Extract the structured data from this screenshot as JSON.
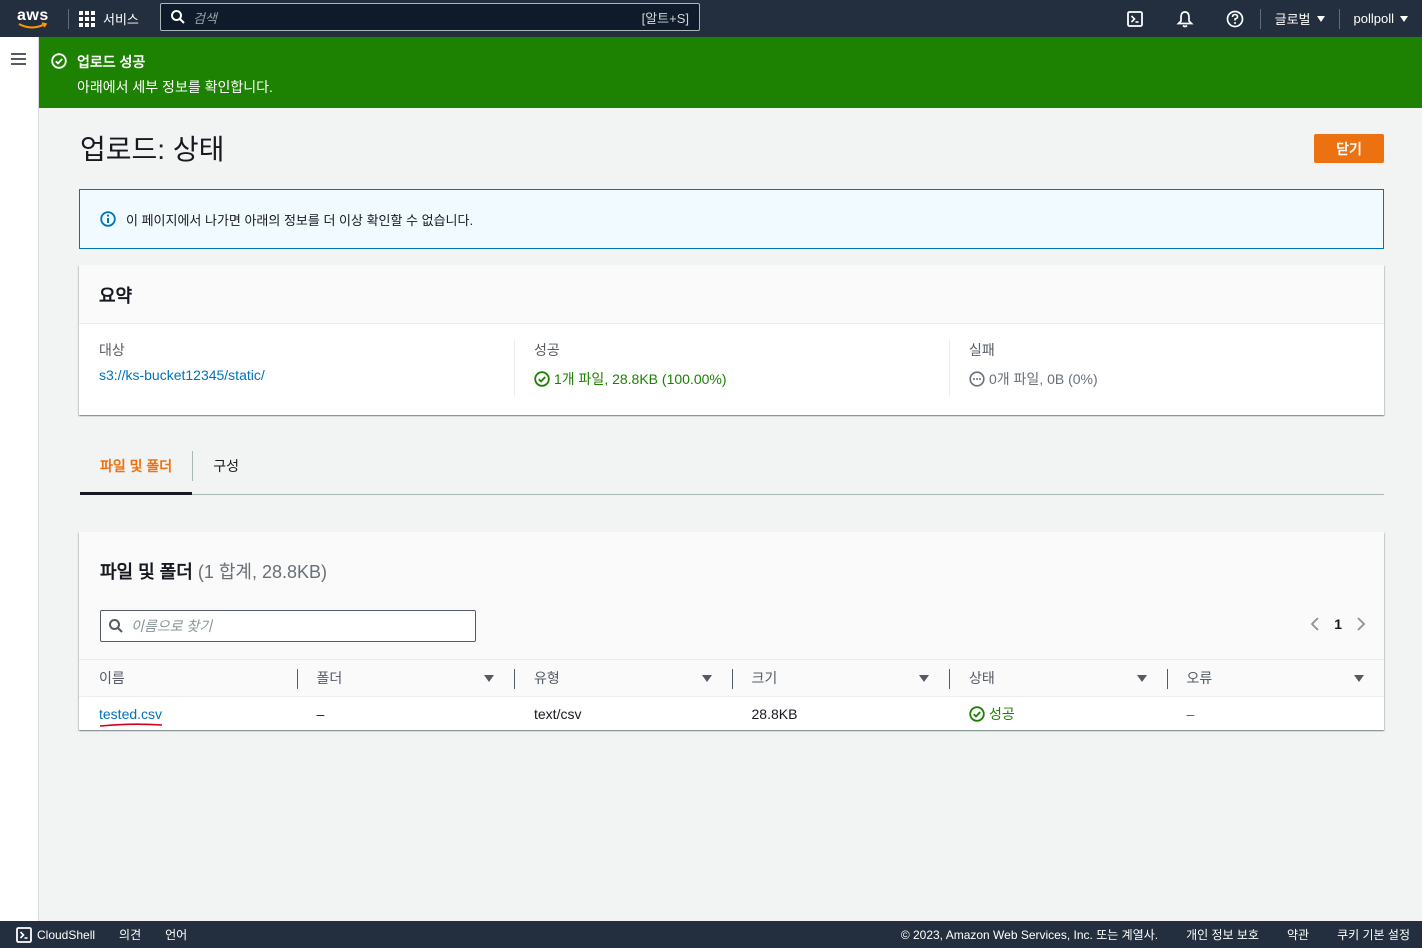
{
  "nav": {
    "logo": "aws",
    "services": "서비스",
    "search_placeholder": "검색",
    "search_shortcut": "[알트+S]",
    "region": "글로벌",
    "account": "pollpoll"
  },
  "flash": {
    "title": "업로드 성공",
    "message": "아래에서 세부 정보를 확인합니다."
  },
  "page": {
    "title": "업로드: 상태",
    "close_label": "닫기"
  },
  "info_alert": "이 페이지에서 나가면 아래의 정보를 더 이상 확인할 수 없습니다.",
  "summary": {
    "heading": "요약",
    "destination_label": "대상",
    "destination_value": "s3://ks-bucket12345/static/",
    "success_label": "성공",
    "success_value": "1개 파일, 28.8KB (100.00%)",
    "failed_label": "실패",
    "failed_value": "0개 파일, 0B (0%)"
  },
  "tabs": [
    {
      "label": "파일 및 폴더",
      "active": true
    },
    {
      "label": "구성",
      "active": false
    }
  ],
  "files": {
    "title": "파일 및 폴더",
    "count": "(1 합계, 28.8KB)",
    "filter_placeholder": "이름으로 찾기",
    "page": "1",
    "columns": [
      "이름",
      "폴더",
      "유형",
      "크기",
      "상태",
      "오류"
    ],
    "rows": [
      {
        "name": "tested.csv",
        "folder": "–",
        "type": "text/csv",
        "size": "28.8KB",
        "status": "성공",
        "error": "–"
      }
    ]
  },
  "footer": {
    "cloudshell": "CloudShell",
    "feedback": "의견",
    "language": "언어",
    "copyright": "© 2023, Amazon Web Services, Inc. 또는 계열사.",
    "privacy": "개인 정보 보호",
    "terms": "약관",
    "cookies": "쿠키 기본 설정"
  },
  "colors": {
    "nav_bg": "#232f3e",
    "flash_success": "#1d8102",
    "primary_button": "#ec7211",
    "link": "#0073bb",
    "info_border": "#0073bb"
  }
}
